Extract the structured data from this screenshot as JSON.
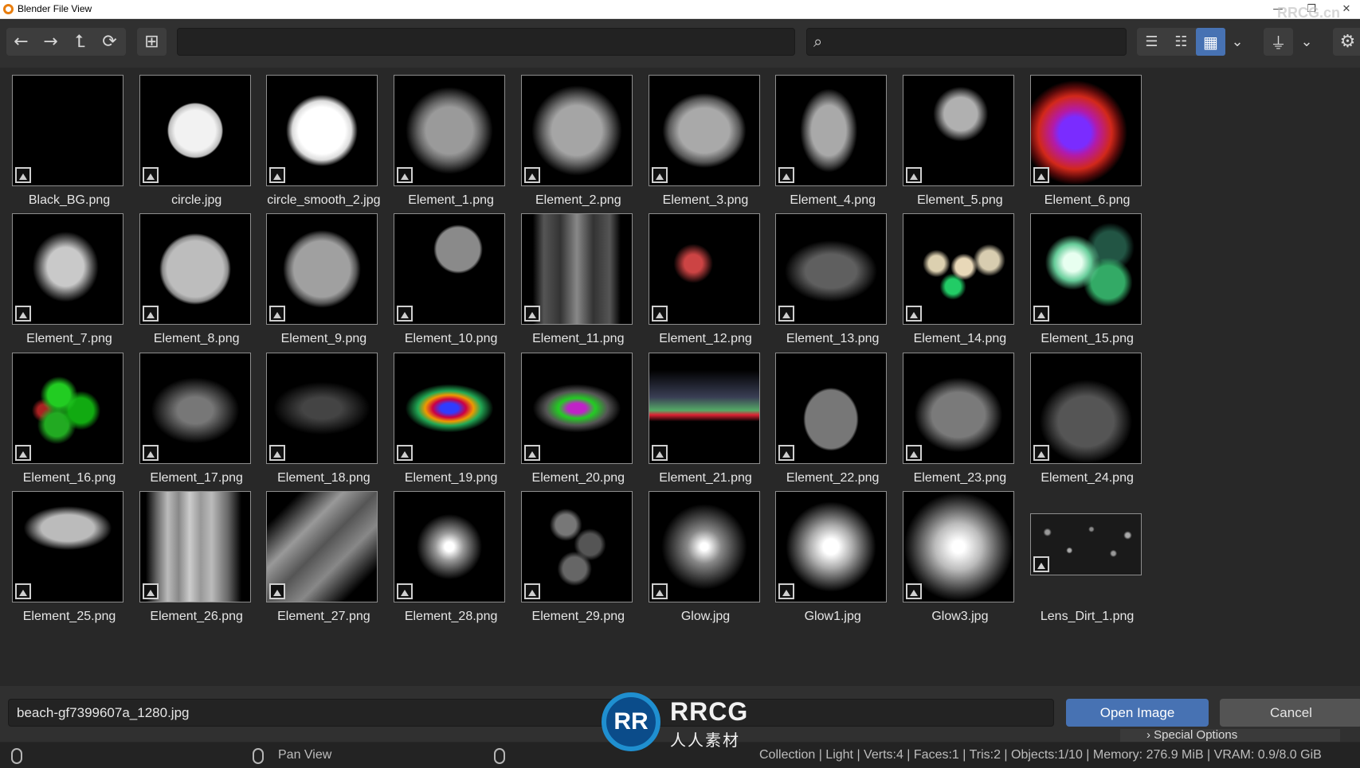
{
  "window": {
    "title": "Blender File View",
    "controls": [
      "—",
      "❐",
      "✕"
    ]
  },
  "toolbar": {
    "nav_buttons": [
      {
        "icon": "arrow-left-icon",
        "glyph": "←"
      },
      {
        "icon": "arrow-right-icon",
        "glyph": "→"
      },
      {
        "icon": "parent-directory-icon",
        "glyph": "⮤"
      },
      {
        "icon": "refresh-icon",
        "glyph": "⟳"
      }
    ],
    "new_folder_glyph": "⊞",
    "path_value": "",
    "search_value": "",
    "search_glyph": "⌕",
    "display_modes": [
      {
        "icon": "vertical-list-icon",
        "glyph": "☰",
        "active": false
      },
      {
        "icon": "horizontal-list-icon",
        "glyph": "☷",
        "active": false
      },
      {
        "icon": "thumbnails-icon",
        "glyph": "▦",
        "active": true
      }
    ],
    "dropdown_glyph": "⌄",
    "filter_glyph": "⏚",
    "settings_glyph": "⚙"
  },
  "files": [
    "Black_BG.png",
    "circle.jpg",
    "circle_smooth_2.jpg",
    "Element_1.png",
    "Element_2.png",
    "Element_3.png",
    "Element_4.png",
    "Element_5.png",
    "Element_6.png",
    "Element_7.png",
    "Element_8.png",
    "Element_9.png",
    "Element_10.png",
    "Element_11.png",
    "Element_12.png",
    "Element_13.png",
    "Element_14.png",
    "Element_15.png",
    "Element_16.png",
    "Element_17.png",
    "Element_18.png",
    "Element_19.png",
    "Element_20.png",
    "Element_21.png",
    "Element_22.png",
    "Element_23.png",
    "Element_24.png",
    "Element_25.png",
    "Element_26.png",
    "Element_27.png",
    "Element_28.png",
    "Element_29.png",
    "Glow.jpg",
    "Glow1.jpg",
    "Glow3.jpg",
    "Lens_Dirt_1.png"
  ],
  "bottom": {
    "filename": "beach-gf7399607a_1280.jpg",
    "open_label": "Open Image",
    "cancel_label": "Cancel",
    "special_options": "› Special Options"
  },
  "status": {
    "pan_view": "Pan View",
    "stats": "Collection | Light | Verts:4 | Faces:1 | Tris:2 | Objects:1/10 | Memory: 276.9 MiB | VRAM: 0.9/8.0 GiB"
  },
  "watermark": {
    "logo": "RR",
    "text": "RRCG",
    "sub": "人人素材",
    "corner": "RRCG.cn"
  },
  "colors": {
    "accent": "#4772b3",
    "background": "#282828",
    "panel": "#303030"
  }
}
